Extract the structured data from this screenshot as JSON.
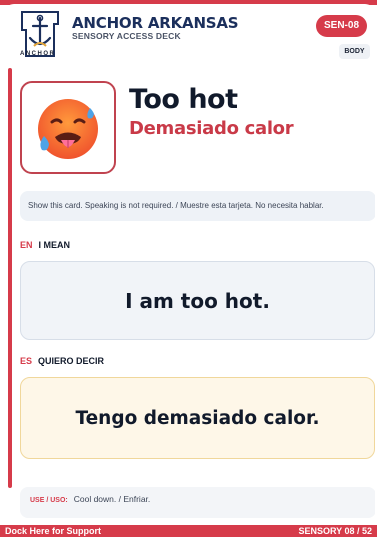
{
  "header": {
    "logo_text": "ANCHOR",
    "org_name": "ANCHOR ARKANSAS",
    "deck_name": "SENSORY ACCESS DECK",
    "card_code": "SEN-08",
    "category": "BODY"
  },
  "card": {
    "emoji_icon": "hot-face-icon",
    "title_en": "Too hot",
    "title_es": "Demasiado calor",
    "instruction": "Show this card. Speaking is not required. / Muestre esta tarjeta. No necesita hablar."
  },
  "sections": {
    "en": {
      "lang": "EN",
      "label": "I MEAN",
      "phrase": "I am too hot."
    },
    "es": {
      "lang": "ES",
      "label": "QUIERO DECIR",
      "phrase": "Tengo demasiado calor."
    }
  },
  "use": {
    "label": "USE / USO:",
    "text": "Cool down. / Enfriar."
  },
  "footer": {
    "left": "Dock Here for Support",
    "right": "SENSORY 08 / 52"
  },
  "colors": {
    "accent": "#d63b4a",
    "navy": "#1b2f5c",
    "phrase_en_bg": "#f1f4f8",
    "phrase_es_bg": "#fef7e8"
  }
}
